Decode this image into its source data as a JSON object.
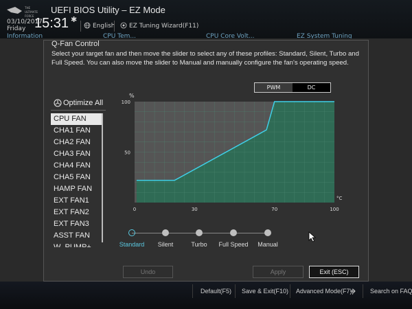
{
  "header": {
    "app_title": "UEFI BIOS Utility – EZ Mode",
    "date": "03/10/2017",
    "day": "Friday",
    "time": "15:31",
    "language": "English",
    "wizard": "EZ Tuning Wizard(F11)",
    "tabs_peek": [
      "Information",
      "CPU Tem...",
      "CPU Core Volt...",
      "EZ System Tuning"
    ]
  },
  "dialog": {
    "title": "Q-Fan Control",
    "description": "Select your target fan and then move the slider to select any of these profiles: Standard, Silent, Turbo and Full Speed. You can also move the slider to Manual and manually configure the fan's operating speed.",
    "optimize_all": "Optimize All",
    "fans": [
      "CPU FAN",
      "CHA1 FAN",
      "CHA2 FAN",
      "CHA3 FAN",
      "CHA4 FAN",
      "CHA5 FAN",
      "HAMP FAN",
      "EXT FAN1",
      "EXT FAN2",
      "EXT FAN3",
      "ASST FAN",
      "W_PUMP+"
    ],
    "selected_fan": "CPU FAN",
    "mode": {
      "pwm": "PWM",
      "dc": "DC",
      "active": "PWM"
    },
    "profiles": [
      "Standard",
      "Silent",
      "Turbo",
      "Full Speed",
      "Manual"
    ],
    "selected_profile": "Standard",
    "buttons": {
      "undo": "Undo",
      "apply": "Apply",
      "exit": "Exit (ESC)"
    }
  },
  "chart_data": {
    "type": "line",
    "x": [
      1,
      20,
      66,
      70,
      100
    ],
    "y": [
      22,
      22,
      72,
      100,
      100
    ],
    "ylabel": "%",
    "xlabel": "°C",
    "xlim": [
      0,
      100
    ],
    "ylim": [
      0,
      100
    ],
    "xticks": [
      0,
      30,
      70,
      100
    ],
    "yticks": [
      50,
      100
    ],
    "grid": true,
    "color": "#3fd0e8"
  },
  "footer": {
    "default": "Default(F5)",
    "save_exit": "Save & Exit(F10)",
    "advanced": "Advanced Mode(F7)|",
    "search": "Search on FAQ"
  },
  "colors": {
    "accent": "#5ac8e0",
    "chart_fill": "#2f6b55",
    "grid": "#4f8a74"
  }
}
